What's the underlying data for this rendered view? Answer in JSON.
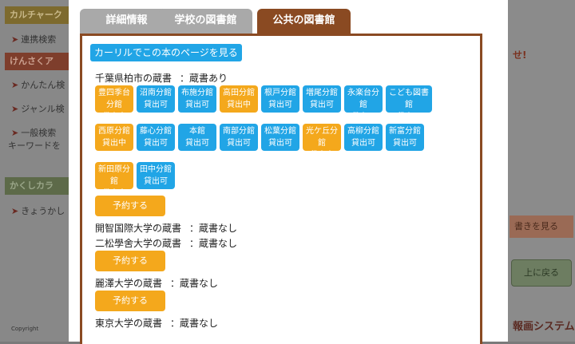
{
  "background": {
    "bands": [
      "カルチャーク",
      "けんさくア",
      "かくしカラ"
    ],
    "links": [
      "連携検索",
      "かんたん検",
      "ジャンル検",
      "一般検索",
      "キーワードを",
      "きょうかし"
    ],
    "right_text_top": "せ!",
    "right_btn1": "書きを見る",
    "right_btn2": "上に戻る",
    "right_text_bottom": "報画システム",
    "footer_small": "Copyright"
  },
  "tabs": [
    {
      "label": "詳細情報",
      "active": false
    },
    {
      "label": "学校の図書館",
      "active": false
    },
    {
      "label": "公共の図書館",
      "active": true
    }
  ],
  "calil_button": "カーリルでこの本のページを見る",
  "libraries": [
    {
      "name": "千葉県柏市の蔵書",
      "status": "：蔵書あり",
      "branches": [
        {
          "name": "豊四季台分館",
          "status": "貸出中",
          "state": "lent"
        },
        {
          "name": "沼南分館",
          "status": "貸出可",
          "state": "avail"
        },
        {
          "name": "布施分館",
          "status": "貸出可",
          "state": "avail"
        },
        {
          "name": "高田分館",
          "status": "貸出中",
          "state": "lent"
        },
        {
          "name": "根戸分館",
          "status": "貸出可",
          "state": "avail"
        },
        {
          "name": "増尾分館",
          "status": "貸出可",
          "state": "avail"
        },
        {
          "name": "永楽台分館",
          "status": "貸出可",
          "state": "avail"
        },
        {
          "name": "こども図書館",
          "status": "貸出可",
          "state": "avail"
        },
        {
          "name": "西原分館",
          "status": "貸出中",
          "state": "lent"
        },
        {
          "name": "藤心分館",
          "status": "貸出可",
          "state": "avail"
        },
        {
          "name": "本館",
          "status": "貸出可",
          "state": "avail"
        },
        {
          "name": "南部分館",
          "status": "貸出可",
          "state": "avail"
        },
        {
          "name": "松葉分館",
          "status": "貸出可",
          "state": "avail"
        },
        {
          "name": "光ケ丘分館",
          "status": "貸出中",
          "state": "lent"
        },
        {
          "name": "高柳分館",
          "status": "貸出可",
          "state": "avail"
        },
        {
          "name": "新富分館",
          "status": "貸出可",
          "state": "avail"
        },
        {
          "name": "新田原分館",
          "status": "貸出中",
          "state": "lent"
        },
        {
          "name": "田中分館",
          "status": "貸出可",
          "state": "avail"
        }
      ],
      "reserve": "予約する"
    },
    {
      "name": "開智国際大学の蔵書",
      "status": "：蔵書なし"
    },
    {
      "name": "二松學舍大学の蔵書",
      "status": "：蔵書なし",
      "reserve": "予約する"
    },
    {
      "name": "麗澤大学の蔵書",
      "status": "：蔵書なし",
      "reserve": "予約する"
    },
    {
      "name": "東京大学の蔵書",
      "status": "：蔵書なし"
    }
  ],
  "colors": {
    "accent": "#8a4a22",
    "available": "#21a5e6",
    "lent": "#f4a81c",
    "tab_inactive": "#a9a9a9"
  }
}
